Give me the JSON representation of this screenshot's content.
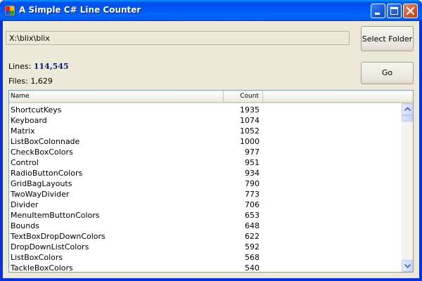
{
  "window": {
    "title": "A Simple C# Line Counter"
  },
  "toolbar": {
    "path_value": "X:\\blix\\blix",
    "select_folder_label": "Select Folder",
    "go_label": "Go"
  },
  "stats": {
    "lines_label": "Lines:",
    "lines_value": "114,545",
    "files_label": "Files:",
    "files_value": "1,629"
  },
  "list": {
    "columns": [
      "Name",
      "Count"
    ],
    "rows": [
      {
        "name": "ShortcutKeys",
        "count": "1935"
      },
      {
        "name": "Keyboard",
        "count": "1074"
      },
      {
        "name": "Matrix",
        "count": "1052"
      },
      {
        "name": "ListBoxColonnade",
        "count": "1000"
      },
      {
        "name": "CheckBoxColors",
        "count": "977"
      },
      {
        "name": "Control",
        "count": "951"
      },
      {
        "name": "RadioButtonColors",
        "count": "934"
      },
      {
        "name": "GridBagLayouts",
        "count": "790"
      },
      {
        "name": "TwoWayDivider",
        "count": "773"
      },
      {
        "name": "Divider",
        "count": "706"
      },
      {
        "name": "MenuItemButtonColors",
        "count": "653"
      },
      {
        "name": "Bounds",
        "count": "648"
      },
      {
        "name": "TextBoxDropDownColors",
        "count": "622"
      },
      {
        "name": "DropDownListColors",
        "count": "592"
      },
      {
        "name": "ListBoxColors",
        "count": "568"
      },
      {
        "name": "TackleBoxColors",
        "count": "540"
      }
    ]
  },
  "icons": {
    "app": "app-icon",
    "minimize": "minimize-icon",
    "maximize": "maximize-icon",
    "close": "close-icon",
    "scroll_up": "arrow-up-icon",
    "scroll_down": "arrow-down-icon"
  },
  "colors": {
    "titlebar": "#0058ee",
    "window_border": "#0831d9",
    "lines_value": "#0a1a8c",
    "close_button": "#d25a2f"
  }
}
